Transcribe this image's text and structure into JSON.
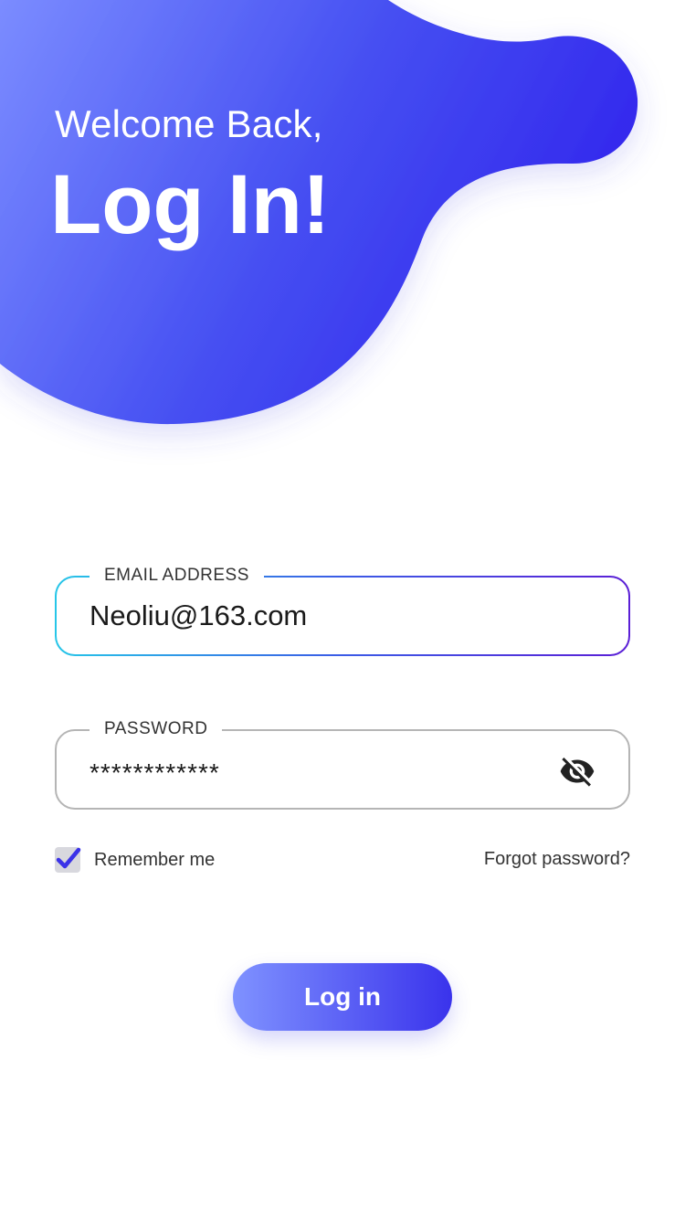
{
  "header": {
    "welcome": "Welcome Back,",
    "title": "Log In!"
  },
  "email": {
    "label": "EMAIL ADDRESS",
    "value": "Neoliu@163.com"
  },
  "password": {
    "label": "PASSWORD",
    "value": "************",
    "toggle_icon": "eye-off-icon"
  },
  "remember": {
    "label": "Remember me",
    "checked": true
  },
  "forgot": {
    "label": "Forgot password?"
  },
  "login_button": {
    "label": "Log in"
  },
  "colors": {
    "accent_start": "#7f92ff",
    "accent_end": "#3a33ec",
    "email_border_start": "#26c6e8",
    "email_border_end": "#5b1fd6",
    "checkmark": "#3b33e8"
  }
}
